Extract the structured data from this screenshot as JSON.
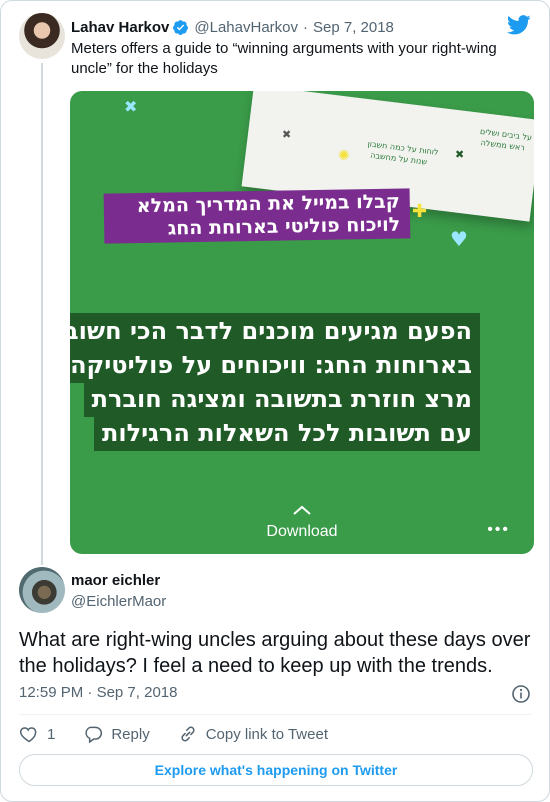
{
  "parent": {
    "name": "Lahav Harkov",
    "handle": "@LahavHarkov",
    "separator": "·",
    "date": "Sep 7, 2018",
    "text": "Meters offers a guide to “winning arguments with your right-wing uncle” for the holidays",
    "media": {
      "purple_banner": [
        "קבלו במייל את המדריך המלא",
        "לויכוח פוליטי בארוחת החג"
      ],
      "body_lines": [
        "הפעם מגיעים מוכנים לדבר הכי חשוב",
        "בארוחות החג: וויכוחים על פוליטיקה.",
        "מרצ חוזרת בתשובה ומציגה חוברת",
        "עם תשובות לכל השאלות הרגילות"
      ],
      "booklet_lines": [
        "על ביבים ושלים",
        "ראש ממשלה",
        "לוחות על כמה חשבון",
        "שנות על מחשבה"
      ],
      "download_label": "Download",
      "more_label": "•••"
    }
  },
  "tweet": {
    "name": "maor eichler",
    "handle": "@EichlerMaor",
    "text": "What are right-wing uncles arguing about these days over the holidays? I feel a need to keep up with the trends.",
    "time": "12:59 PM",
    "separator": "·",
    "date": "Sep 7, 2018"
  },
  "actions": {
    "like_count": "1",
    "reply_label": "Reply",
    "copy_label": "Copy link to Tweet"
  },
  "explore_label": "Explore what's happening on Twitter",
  "colors": {
    "brand_blue": "#1d9bf0",
    "media_green": "#3a9b49",
    "banner_purple": "#7b2d8f",
    "text_highlight": "#1f5a27"
  },
  "icons": [
    "twitter-logo-icon",
    "verified-badge-icon",
    "chevron-up-icon",
    "info-icon",
    "heart-icon",
    "reply-icon",
    "link-icon"
  ]
}
